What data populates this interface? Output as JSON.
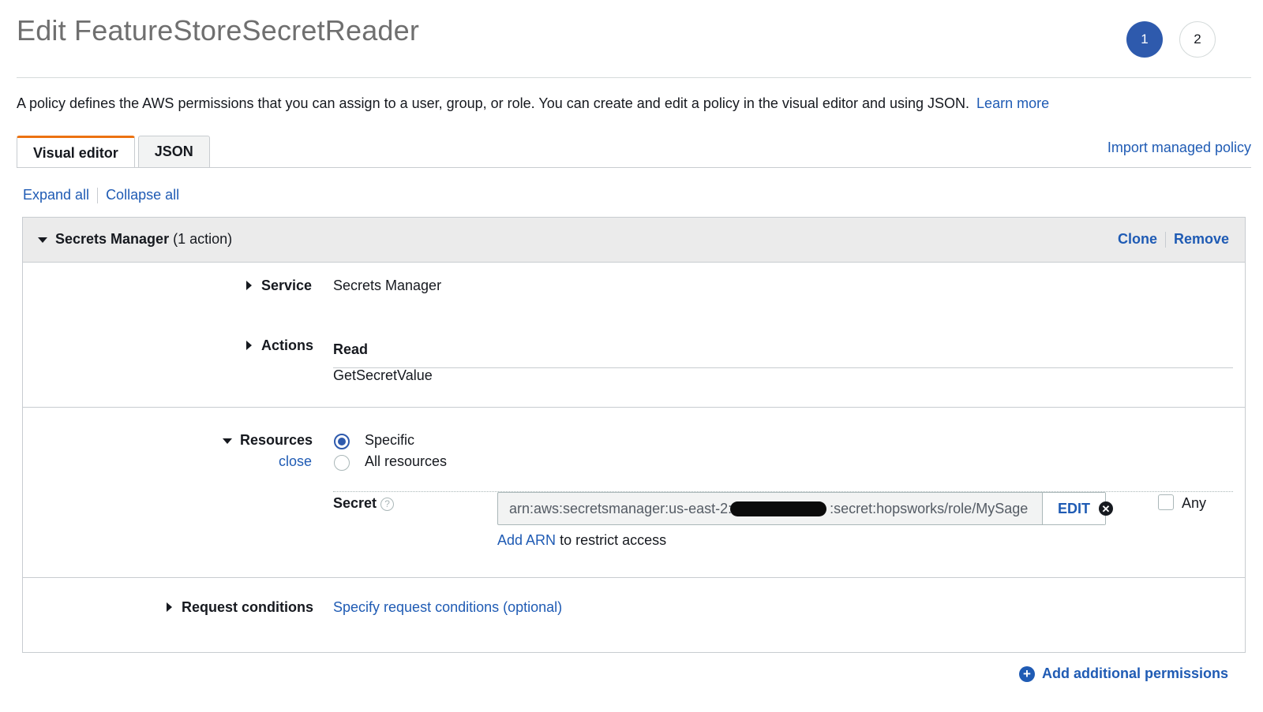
{
  "page": {
    "title": "Edit FeatureStoreSecretReader",
    "steps": [
      "1",
      "2"
    ]
  },
  "intro": {
    "text": "A policy defines the AWS permissions that you can assign to a user, group, or role. You can create and edit a policy in the visual editor and using JSON.",
    "learn_more": "Learn more"
  },
  "tabs": [
    {
      "label": "Visual editor",
      "active": true
    },
    {
      "label": "JSON",
      "active": false
    }
  ],
  "import_link": "Import managed policy",
  "controls": {
    "expand_all": "Expand all",
    "collapse_all": "Collapse all"
  },
  "statement": {
    "service_title": "Secrets Manager",
    "action_count": "(1 action)",
    "clone": "Clone",
    "remove": "Remove",
    "service": {
      "label": "Service",
      "value": "Secrets Manager"
    },
    "actions": {
      "label": "Actions",
      "group": "Read",
      "value": "GetSecretValue"
    },
    "resources": {
      "label": "Resources",
      "close": "close",
      "options": [
        "Specific",
        "All resources"
      ],
      "selected": "Specific",
      "secret_label": "Secret",
      "help": "?",
      "arn_prefix": "arn:aws:secretsmanager:us-east-2:",
      "arn_suffix": ":secret:hopsworks/role/MySage",
      "edit": "EDIT",
      "any": "Any",
      "add_arn": "Add ARN",
      "add_arn_suffix": "to restrict access"
    },
    "request_conditions": {
      "label": "Request conditions",
      "link": "Specify request conditions (optional)"
    }
  },
  "add_permissions": "Add additional permissions"
}
